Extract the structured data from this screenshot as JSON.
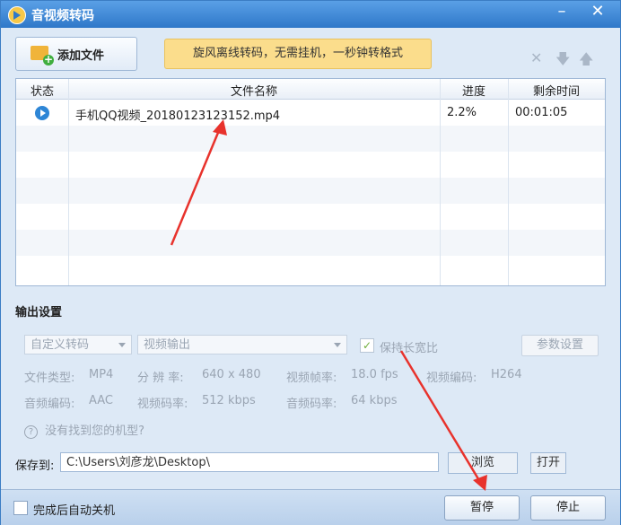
{
  "window": {
    "title": "音视频转码",
    "min_label": "–",
    "close_label": "✕"
  },
  "toolbar": {
    "add_file_label": "添加文件",
    "banner": "旋风离线转码，无需挂机，一秒钟转格式",
    "delete_icon": "✕",
    "down_icon": "🡇",
    "up_icon": "🡅"
  },
  "table": {
    "headers": [
      "状态",
      "文件名称",
      "进度",
      "剩余时间"
    ],
    "rows": [
      {
        "status_icon": "play-arrow-icon",
        "filename": "手机QQ视频_20180123123152.mp4",
        "progress": "2.2%",
        "remaining": "00:01:05"
      }
    ]
  },
  "output": {
    "section_title": "输出设置",
    "preset": "自定义转码",
    "mode": "视频输出",
    "keep_ratio_check": "✓",
    "keep_ratio": "保持长宽比",
    "params_button": "参数设置",
    "file_type_label": "文件类型:",
    "file_type": "MP4",
    "resolution_label": "分 辨 率:",
    "resolution": "640 x 480",
    "framerate_label": "视频帧率:",
    "framerate": "18.0 fps",
    "vcodec_label": "视频编码:",
    "vcodec": "H264",
    "acodec_label": "音频编码:",
    "acodec": "AAC",
    "vbitrate_label": "视频码率:",
    "vbitrate": "512 kbps",
    "abitrate_label": "音频码率:",
    "abitrate": "64 kbps",
    "help_icon": "?",
    "help_text": "没有找到您的机型?"
  },
  "save": {
    "label": "保存到:",
    "path": "C:\\Users\\刘彦龙\\Desktop\\",
    "browse": "浏览",
    "open": "打开"
  },
  "bottom": {
    "auto_shutdown": "完成后自动关机",
    "pause": "暂停",
    "stop": "停止"
  },
  "colors": {
    "titlebar": "#2f78c9",
    "banner": "#fbdd8c",
    "annotation_arrow": "#e8322c"
  }
}
